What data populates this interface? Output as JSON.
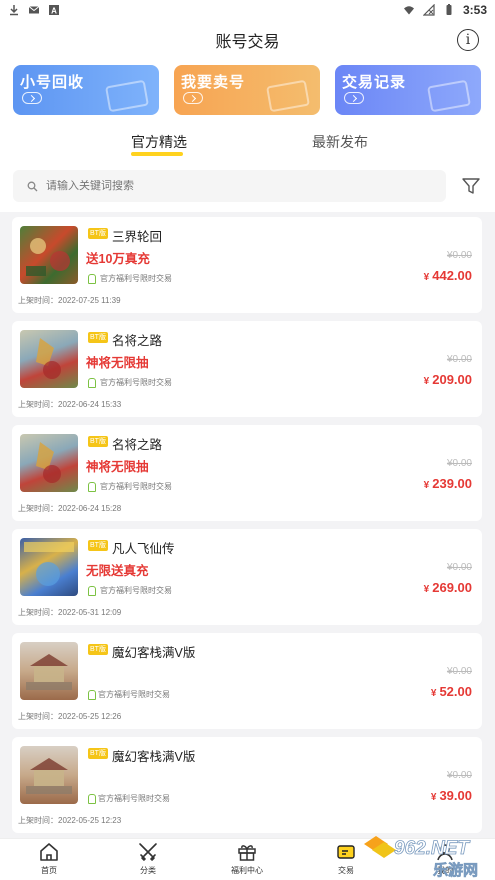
{
  "status": {
    "time": "3:53"
  },
  "header": {
    "title": "账号交易"
  },
  "cards": [
    {
      "label": "小号回收",
      "color": "#6b9ef5"
    },
    {
      "label": "我要卖号",
      "color": "#f6aa5c"
    },
    {
      "label": "交易记录",
      "color": "#7a94f8"
    }
  ],
  "tabs": [
    {
      "label": "官方精选",
      "active": true
    },
    {
      "label": "最新发布",
      "active": false
    }
  ],
  "search": {
    "placeholder": "请输入关键词搜索"
  },
  "items": [
    {
      "badge": "BT版",
      "name": "三界轮回",
      "promo": "送10万真充",
      "platform": "官方福利号限时交易",
      "old_price": "¥0.00",
      "currency": "¥",
      "price": "442.00",
      "time": "上架时间：2022-07-25 11:39"
    },
    {
      "badge": "BT版",
      "name": "名将之路",
      "promo": "神将无限抽",
      "platform": "官方福利号限时交易",
      "old_price": "¥0.00",
      "currency": "¥",
      "price": "209.00",
      "time": "上架时间：2022-06-24 15:33"
    },
    {
      "badge": "BT版",
      "name": "名将之路",
      "promo": "神将无限抽",
      "platform": "官方福利号限时交易",
      "old_price": "¥0.00",
      "currency": "¥",
      "price": "239.00",
      "time": "上架时间：2022-06-24 15:28"
    },
    {
      "badge": "BT版",
      "name": "凡人飞仙传",
      "promo": "无限送真充",
      "platform": "官方福利号限时交易",
      "old_price": "¥0.00",
      "currency": "¥",
      "price": "269.00",
      "time": "上架时间：2022-05-31 12:09"
    },
    {
      "badge": "BT版",
      "name": "魔幻客栈满V版",
      "promo": "",
      "platform": "官方福利号限时交易",
      "old_price": "¥0.00",
      "currency": "¥",
      "price": "52.00",
      "time": "上架时间：2022-05-25 12:26"
    },
    {
      "badge": "BT版",
      "name": "魔幻客栈满V版",
      "promo": "",
      "platform": "官方福利号限时交易",
      "old_price": "¥0.00",
      "currency": "¥",
      "price": "39.00",
      "time": "上架时间：2022-05-25 12:23"
    }
  ],
  "nav": [
    {
      "label": "首页",
      "icon": "home-icon"
    },
    {
      "label": "分类",
      "icon": "crossed-swords-icon"
    },
    {
      "label": "福利中心",
      "icon": "gift-icon"
    },
    {
      "label": "交易",
      "icon": "trade-icon"
    },
    {
      "label": "我的",
      "icon": "user-icon"
    }
  ],
  "watermark": {
    "brand": "962.NET",
    "sub": "乐游网"
  },
  "colors": {
    "accent": "#ffd21e",
    "price": "#e53935",
    "badge": "#f5c518"
  }
}
